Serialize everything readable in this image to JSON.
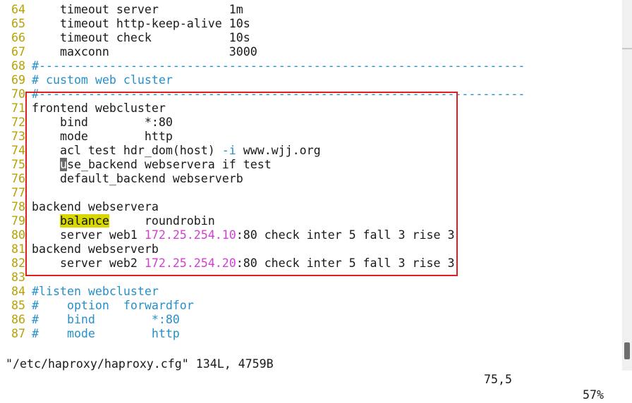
{
  "lines": [
    {
      "n": "64",
      "s": [
        {
          "t": "    timeout server          1m"
        }
      ]
    },
    {
      "n": "65",
      "s": [
        {
          "t": "    timeout http-keep-alive 10s"
        }
      ]
    },
    {
      "n": "66",
      "s": [
        {
          "t": "    timeout check           10s"
        }
      ]
    },
    {
      "n": "67",
      "s": [
        {
          "t": "    maxconn                 3000"
        }
      ]
    },
    {
      "n": "68",
      "s": [
        {
          "t": "#---------------------------------------------------------------------",
          "c": "c"
        }
      ]
    },
    {
      "n": "69",
      "s": [
        {
          "t": "# custom web cluster",
          "c": "c"
        }
      ]
    },
    {
      "n": "70",
      "s": [
        {
          "t": "#---------------------------------------------------------------------",
          "c": "c"
        }
      ]
    },
    {
      "n": "71",
      "s": [
        {
          "t": "frontend webcluster"
        }
      ]
    },
    {
      "n": "72",
      "s": [
        {
          "t": "    bind        *:80"
        }
      ]
    },
    {
      "n": "73",
      "s": [
        {
          "t": "    mode        http"
        }
      ]
    },
    {
      "n": "74",
      "s": [
        {
          "t": "    acl test hdr_dom(host) "
        },
        {
          "t": "-i",
          "c": "c"
        },
        {
          "t": " www.wjj.org"
        }
      ]
    },
    {
      "n": "75",
      "s": [
        {
          "t": "    "
        },
        {
          "t": "u",
          "c": "cursor"
        },
        {
          "t": "se_backend webservera if test"
        }
      ]
    },
    {
      "n": "76",
      "s": [
        {
          "t": "    default_backend webserverb"
        }
      ]
    },
    {
      "n": "77",
      "s": [
        {
          "t": ""
        }
      ]
    },
    {
      "n": "78",
      "s": [
        {
          "t": "backend webservera"
        }
      ]
    },
    {
      "n": "79",
      "s": [
        {
          "t": "    "
        },
        {
          "t": "balance",
          "c": "hl"
        },
        {
          "t": "     roundrobin"
        }
      ]
    },
    {
      "n": "80",
      "s": [
        {
          "t": "    server web1 "
        },
        {
          "t": "172.25.254.10",
          "c": "ip"
        },
        {
          "t": ":80 check inter 5 fall 3 rise 3"
        }
      ]
    },
    {
      "n": "81",
      "s": [
        {
          "t": "backend webserverb"
        }
      ]
    },
    {
      "n": "82",
      "s": [
        {
          "t": "    server web2 "
        },
        {
          "t": "172.25.254.20",
          "c": "ip"
        },
        {
          "t": ":80 check inter 5 fall 3 rise 3"
        }
      ]
    },
    {
      "n": "83",
      "s": [
        {
          "t": ""
        }
      ]
    },
    {
      "n": "84",
      "s": [
        {
          "t": "#listen webcluster",
          "c": "c"
        }
      ]
    },
    {
      "n": "85",
      "s": [
        {
          "t": "#    option  forwardfor",
          "c": "c"
        }
      ]
    },
    {
      "n": "86",
      "s": [
        {
          "t": "#    bind        *:80",
          "c": "c"
        }
      ]
    },
    {
      "n": "87",
      "s": [
        {
          "t": "#    mode        http",
          "c": "c"
        }
      ]
    }
  ],
  "status": {
    "file": "\"/etc/haproxy/haproxy.cfg\" 134L, 4759B",
    "position": "75,5",
    "percent": "57%"
  },
  "colors": {
    "line_number": "#b8a100",
    "comment": "#2690c8",
    "ip_address": "#d23fd2",
    "search_highlight": "#d8d800",
    "annotation_box": "#e02020"
  }
}
